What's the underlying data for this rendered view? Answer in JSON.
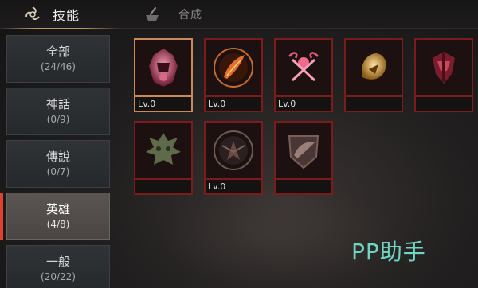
{
  "tabs": {
    "skills": {
      "label": "技能",
      "icon": "triskelion-icon"
    },
    "combine": {
      "label": "合成",
      "icon": "mortar-icon"
    }
  },
  "sidebar": {
    "items": [
      {
        "name": "全部",
        "count": "(24/46)",
        "active": false
      },
      {
        "name": "神話",
        "count": "(0/9)",
        "active": false
      },
      {
        "name": "傳說",
        "count": "(0/7)",
        "active": false
      },
      {
        "name": "英雄",
        "count": "(4/8)",
        "active": true
      },
      {
        "name": "一般",
        "count": "(20/22)",
        "active": false
      }
    ]
  },
  "skills": [
    {
      "icon": "armored-knight-icon",
      "level": "Lv.0",
      "selected": true
    },
    {
      "icon": "flaming-feather-icon",
      "level": "Lv.0",
      "selected": false
    },
    {
      "icon": "twin-serpent-emblem-icon",
      "level": "Lv.0",
      "selected": false
    },
    {
      "icon": "golden-lion-icon",
      "level": "",
      "selected": false
    },
    {
      "icon": "crimson-crest-icon",
      "level": "",
      "selected": false
    },
    {
      "icon": "spiked-demon-face-icon",
      "level": "",
      "selected": false
    },
    {
      "icon": "dark-wings-circle-icon",
      "level": "Lv.0",
      "selected": false
    },
    {
      "icon": "dragon-shield-icon",
      "level": "",
      "selected": false
    }
  ],
  "watermark": "PP助手",
  "colors": {
    "accent_red": "#e0412e",
    "frame_red": "#7a1c1c",
    "frame_selected": "#c98a5a",
    "watermark": "#6fd6c2"
  }
}
